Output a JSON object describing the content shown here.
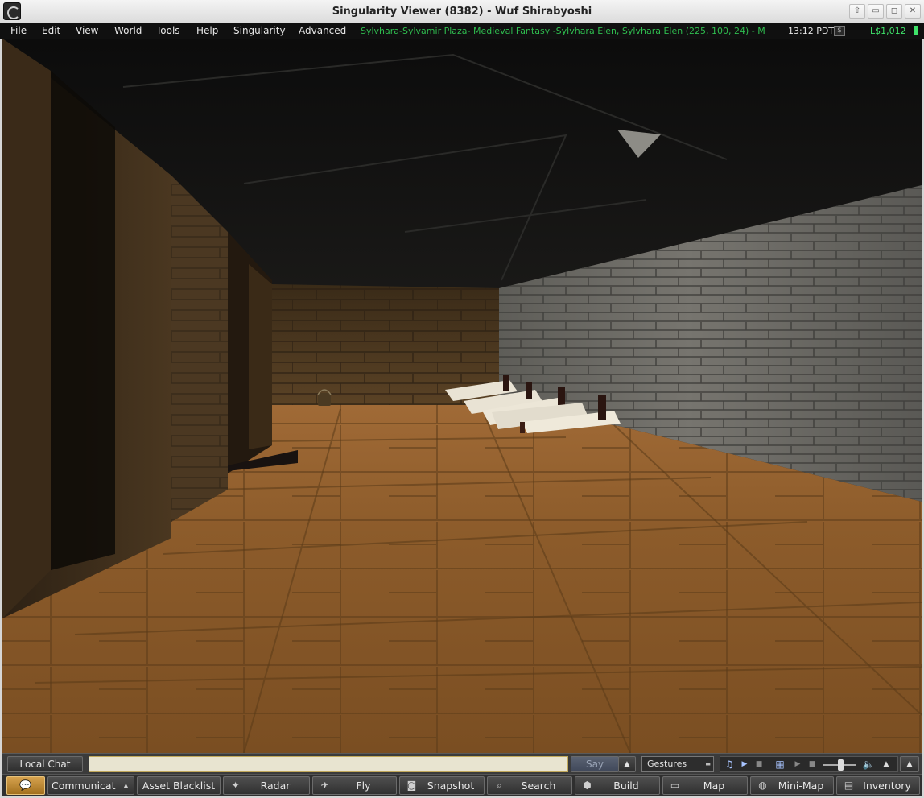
{
  "window": {
    "title": "Singularity Viewer (8382) - Wuf Shirabyoshi",
    "controls": [
      "⇧",
      "▭",
      "◻",
      "✕"
    ]
  },
  "menu": {
    "items": [
      "File",
      "Edit",
      "View",
      "World",
      "Tools",
      "Help",
      "Singularity",
      "Advanced"
    ],
    "location": "Sylvhara-Sylvamir Plaza- Medieval Fantasy -Sylvhara Elen, Sylvhara Elen (225, 100, 24) - M",
    "time": "13:12 PDT",
    "currency_icon": "$",
    "balance": "L$1,012"
  },
  "chat": {
    "local_chat_label": "Local Chat",
    "input_value": "",
    "say_label": "Say",
    "expand_glyph": "▲",
    "gestures_label": "Gestures"
  },
  "media": {
    "icons": [
      "music-note-icon",
      "play-icon",
      "stop-icon",
      "media-icon",
      "play-icon",
      "stop-icon",
      "volume-icon"
    ],
    "music_glyph": "♫",
    "play_glyph": "▶",
    "stop_glyph": "■",
    "film_glyph": "▦",
    "volume_glyph": "🔈",
    "up_glyph": "▲"
  },
  "toolbar": {
    "items": [
      {
        "label": "Communicat",
        "icon": "▲"
      },
      {
        "label": "Asset Blacklist",
        "icon": ""
      },
      {
        "label": "Radar",
        "icon": "✦"
      },
      {
        "label": "Fly",
        "icon": "✈"
      },
      {
        "label": "Snapshot",
        "icon": "◙"
      },
      {
        "label": "Search",
        "icon": "⌕"
      },
      {
        "label": "Build",
        "icon": "⬢"
      },
      {
        "label": "Map",
        "icon": "▭"
      },
      {
        "label": "Mini-Map",
        "icon": "◍"
      },
      {
        "label": "Inventory",
        "icon": "▤"
      }
    ],
    "chat_glyph": "💬"
  },
  "colors": {
    "location_text": "#2fbd4f",
    "balance_text": "#3fe36a",
    "floor": "#8a5a28",
    "grey_wall": "#6a6862",
    "brown_wall": "#4a3720"
  }
}
